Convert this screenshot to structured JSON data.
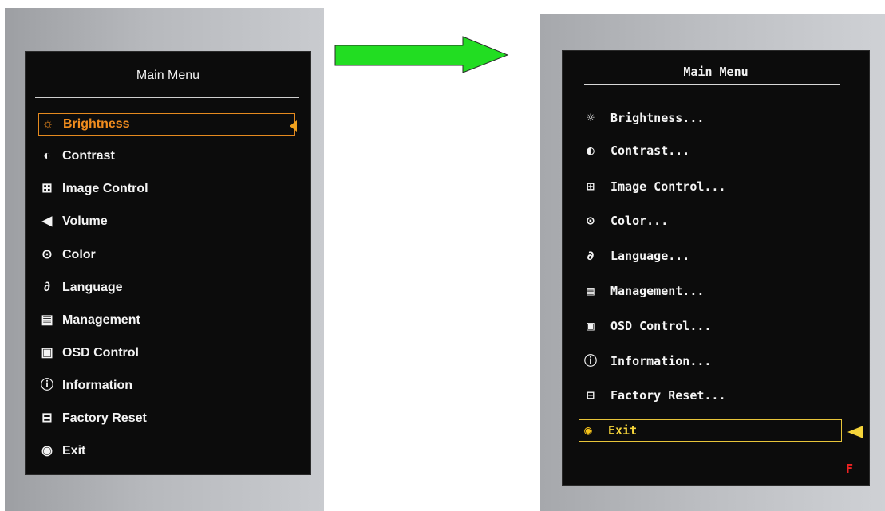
{
  "before": {
    "title": "Main Menu",
    "items": [
      {
        "label": "Brightness",
        "icon": "sun-icon"
      },
      {
        "label": "Contrast",
        "icon": "contrast-icon"
      },
      {
        "label": "Image Control",
        "icon": "image-control-icon"
      },
      {
        "label": "Volume",
        "icon": "speaker-icon"
      },
      {
        "label": "Color",
        "icon": "palette-icon"
      },
      {
        "label": "Language",
        "icon": "language-icon"
      },
      {
        "label": "Management",
        "icon": "management-icon"
      },
      {
        "label": "OSD Control",
        "icon": "osd-control-icon"
      },
      {
        "label": "Information",
        "icon": "information-icon"
      },
      {
        "label": "Factory Reset",
        "icon": "factory-reset-icon"
      },
      {
        "label": "Exit",
        "icon": "exit-icon"
      }
    ],
    "selected_index": 0,
    "highlight_color": "#f08c1e"
  },
  "after": {
    "title": "Main Menu",
    "items": [
      {
        "label": "Brightness...",
        "icon": "sun-icon"
      },
      {
        "label": "Contrast...",
        "icon": "contrast-icon"
      },
      {
        "label": "Image Control...",
        "icon": "image-control-icon"
      },
      {
        "label": "Color...",
        "icon": "palette-icon"
      },
      {
        "label": "Language...",
        "icon": "language-icon"
      },
      {
        "label": "Management...",
        "icon": "management-icon"
      },
      {
        "label": "OSD Control...",
        "icon": "osd-control-icon"
      },
      {
        "label": "Information...",
        "icon": "information-icon"
      },
      {
        "label": "Factory Reset...",
        "icon": "factory-reset-icon"
      },
      {
        "label": "Exit",
        "icon": "exit-icon"
      }
    ],
    "selected_index": 9,
    "corner_mark": "F",
    "highlight_color": "#f5d43a"
  },
  "arrow": {
    "icon": "right-arrow-icon",
    "color": "#22dd22"
  }
}
